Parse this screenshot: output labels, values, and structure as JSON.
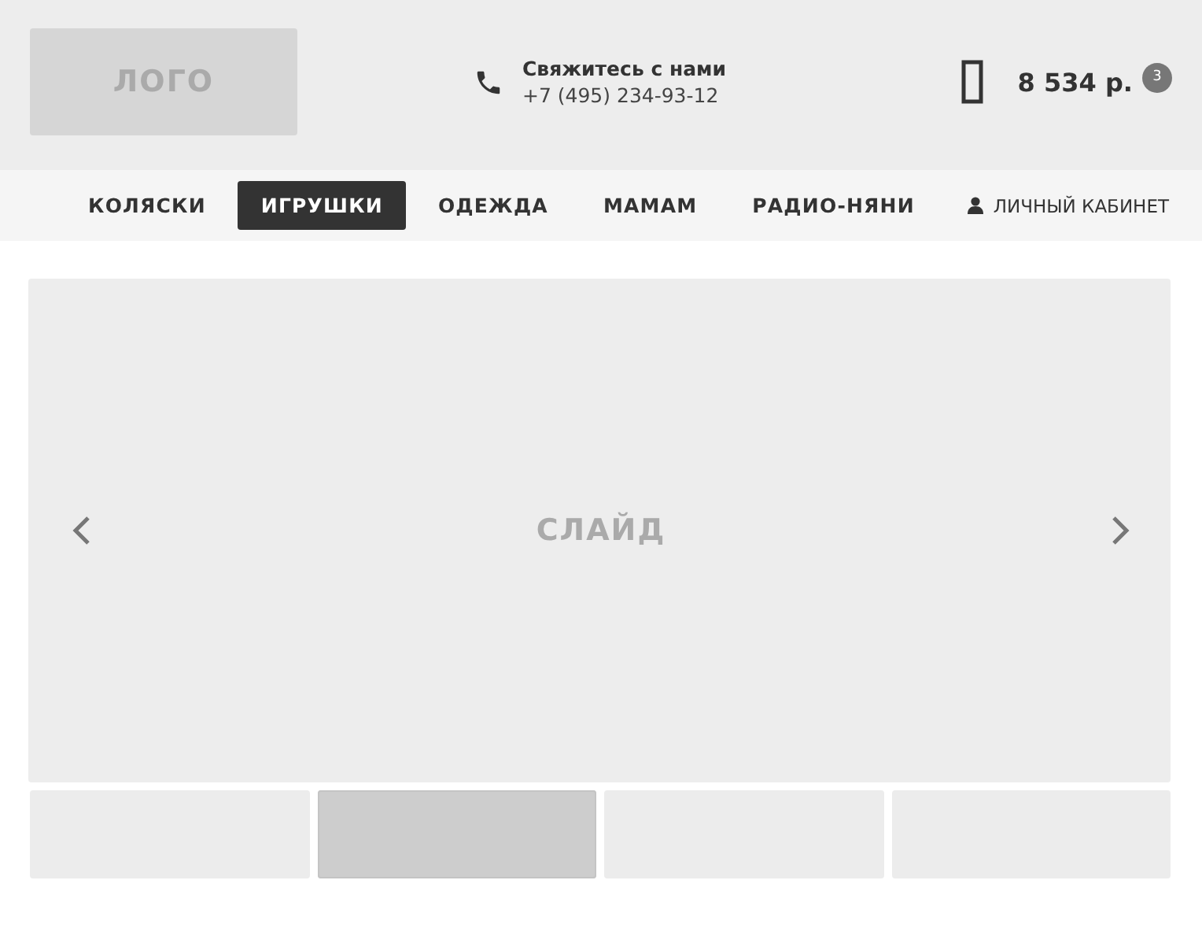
{
  "header": {
    "logo": "ЛОГО",
    "contact": {
      "title": "Свяжитесь с нами",
      "phone": "+7 (495) 234-93-12"
    },
    "cart": {
      "total": "8 534 р.",
      "count": "3"
    }
  },
  "nav": {
    "items": [
      {
        "label": "КОЛЯСКИ",
        "selected": false
      },
      {
        "label": "ИГРУШКИ",
        "selected": true
      },
      {
        "label": "ОДЕЖДА",
        "selected": false
      },
      {
        "label": "МАМАМ",
        "selected": false
      },
      {
        "label": "РАДИО-НЯНИ",
        "selected": false
      }
    ],
    "account": "ЛИЧНЫЙ КАБИНЕТ"
  },
  "slider": {
    "label": "СЛАЙД",
    "thumbnails": [
      {
        "selected": false
      },
      {
        "selected": true
      },
      {
        "selected": false
      },
      {
        "selected": false
      }
    ]
  }
}
